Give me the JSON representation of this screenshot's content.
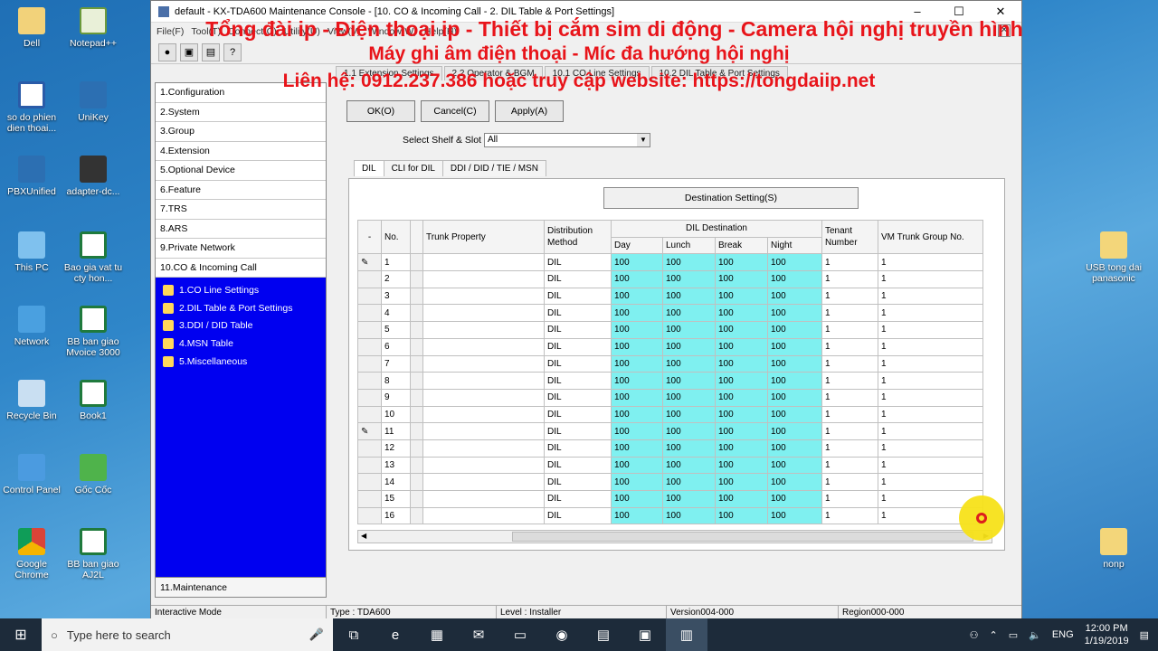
{
  "desktop_left": [
    {
      "label": "Dell",
      "icon": "dell-icon",
      "cls": "ico-dell"
    },
    {
      "label": "Notepad++",
      "icon": "notepad-icon",
      "cls": "ico-note"
    },
    {
      "label": "so do phien dien thoai...",
      "icon": "word-doc-icon",
      "cls": "ico-doc"
    },
    {
      "label": "UniKey",
      "icon": "unikey-icon",
      "cls": "ico-app"
    },
    {
      "label": "PBXUnified",
      "icon": "pbx-icon",
      "cls": "ico-app"
    },
    {
      "label": "adapter-dc...",
      "icon": "adapter-icon",
      "cls": "ico-adapter"
    },
    {
      "label": "This PC",
      "icon": "this-pc-icon",
      "cls": "ico-pc"
    },
    {
      "label": "Bao gia vat tu cty hon...",
      "icon": "excel-icon",
      "cls": "ico-xls"
    },
    {
      "label": "Network",
      "icon": "network-icon",
      "cls": "ico-net"
    },
    {
      "label": "BB ban giao Mvoice 3000",
      "icon": "excel-icon",
      "cls": "ico-xls"
    },
    {
      "label": "Recycle Bin",
      "icon": "recycle-bin-icon",
      "cls": "ico-bin"
    },
    {
      "label": "Book1",
      "icon": "excel-icon",
      "cls": "ico-xls"
    },
    {
      "label": "Control Panel",
      "icon": "control-panel-icon",
      "cls": "ico-cp"
    },
    {
      "label": "Gốc Cốc",
      "icon": "coccoc-icon",
      "cls": "ico-gc"
    },
    {
      "label": "Google Chrome",
      "icon": "chrome-icon",
      "cls": "ico-chrome"
    },
    {
      "label": "BB ban giao AJ2L",
      "icon": "excel-icon",
      "cls": "ico-xls"
    }
  ],
  "desktop_right": [
    {
      "label": "USB tong dai panasonic",
      "icon": "folder-icon"
    },
    {
      "label": "nonp",
      "icon": "folder-icon"
    }
  ],
  "window": {
    "title": "default - KX-TDA600 Maintenance Console - [10. CO & Incoming Call - 2. DIL Table & Port Settings]",
    "menu": [
      "File(F)",
      "Tool(T)",
      "Connect(C)",
      "Utility(U)",
      "View(V)",
      "Window(W)",
      "Help(H)"
    ],
    "mdi_tabs": [
      "1.1 Extension Settings",
      "2.2 Operator & BGM",
      "10.1 CO Line Settings",
      "10.2 DIL Table & Port Settings"
    ]
  },
  "tree": {
    "items": [
      "1.Configuration",
      "2.System",
      "3.Group",
      "4.Extension",
      "5.Optional Device",
      "6.Feature",
      "7.TRS",
      "8.ARS",
      "9.Private Network",
      "10.CO & Incoming Call"
    ],
    "sub": [
      "1.CO Line Settings",
      "2.DIL Table & Port Settings",
      "3.DDI / DID Table",
      "4.MSN Table",
      "5.Miscellaneous"
    ],
    "last": "11.Maintenance"
  },
  "buttons": {
    "ok": "OK(O)",
    "cancel": "Cancel(C)",
    "apply": "Apply(A)",
    "dest": "Destination Setting(S)"
  },
  "shelf": {
    "label": "Select Shelf & Slot",
    "value": "All"
  },
  "subtabs": [
    "DIL",
    "CLI for DIL",
    "DDI / DID / TIE / MSN"
  ],
  "table": {
    "h_dash": "-",
    "h_no": "No.",
    "h_trunk": "Trunk Property",
    "h_dist": "Distribution Method",
    "h_dil": "DIL Destination",
    "h_day": "Day",
    "h_lunch": "Lunch",
    "h_break": "Break",
    "h_night": "Night",
    "h_tenant": "Tenant Number",
    "h_vm": "VM Trunk Group No.",
    "rows": [
      [
        "1",
        "DIL",
        "100",
        "100",
        "100",
        "100",
        "1",
        "1"
      ],
      [
        "2",
        "DIL",
        "100",
        "100",
        "100",
        "100",
        "1",
        "1"
      ],
      [
        "3",
        "DIL",
        "100",
        "100",
        "100",
        "100",
        "1",
        "1"
      ],
      [
        "4",
        "DIL",
        "100",
        "100",
        "100",
        "100",
        "1",
        "1"
      ],
      [
        "5",
        "DIL",
        "100",
        "100",
        "100",
        "100",
        "1",
        "1"
      ],
      [
        "6",
        "DIL",
        "100",
        "100",
        "100",
        "100",
        "1",
        "1"
      ],
      [
        "7",
        "DIL",
        "100",
        "100",
        "100",
        "100",
        "1",
        "1"
      ],
      [
        "8",
        "DIL",
        "100",
        "100",
        "100",
        "100",
        "1",
        "1"
      ],
      [
        "9",
        "DIL",
        "100",
        "100",
        "100",
        "100",
        "1",
        "1"
      ],
      [
        "10",
        "DIL",
        "100",
        "100",
        "100",
        "100",
        "1",
        "1"
      ],
      [
        "11",
        "DIL",
        "100",
        "100",
        "100",
        "100",
        "1",
        "1"
      ],
      [
        "12",
        "DIL",
        "100",
        "100",
        "100",
        "100",
        "1",
        "1"
      ],
      [
        "13",
        "DIL",
        "100",
        "100",
        "100",
        "100",
        "1",
        "1"
      ],
      [
        "14",
        "DIL",
        "100",
        "100",
        "100",
        "100",
        "1",
        "1"
      ],
      [
        "15",
        "DIL",
        "100",
        "100",
        "100",
        "100",
        "1",
        "1"
      ],
      [
        "16",
        "DIL",
        "100",
        "100",
        "100",
        "100",
        "1",
        "1"
      ]
    ]
  },
  "status": {
    "mode": "Interactive Mode",
    "type": "Type : TDA600",
    "level": "Level : Installer",
    "version": "Version004-000",
    "region": "Region000-000"
  },
  "banner": {
    "line1": "Tổng đài ip - Điện thoại ip - Thiết bị cắm sim di động - Camera hội nghị truyền hình",
    "line2": "Máy ghi âm điện thoại - Míc đa hướng hội nghị",
    "line3": "Liên hệ: 0912.237.386 hoặc truy cập website: https://tongdaiip.net",
    "color": "#e8141a"
  },
  "taskbar": {
    "search_placeholder": "Type here to search",
    "lang": "ENG",
    "time": "12:00 PM",
    "date": "1/19/2019"
  }
}
